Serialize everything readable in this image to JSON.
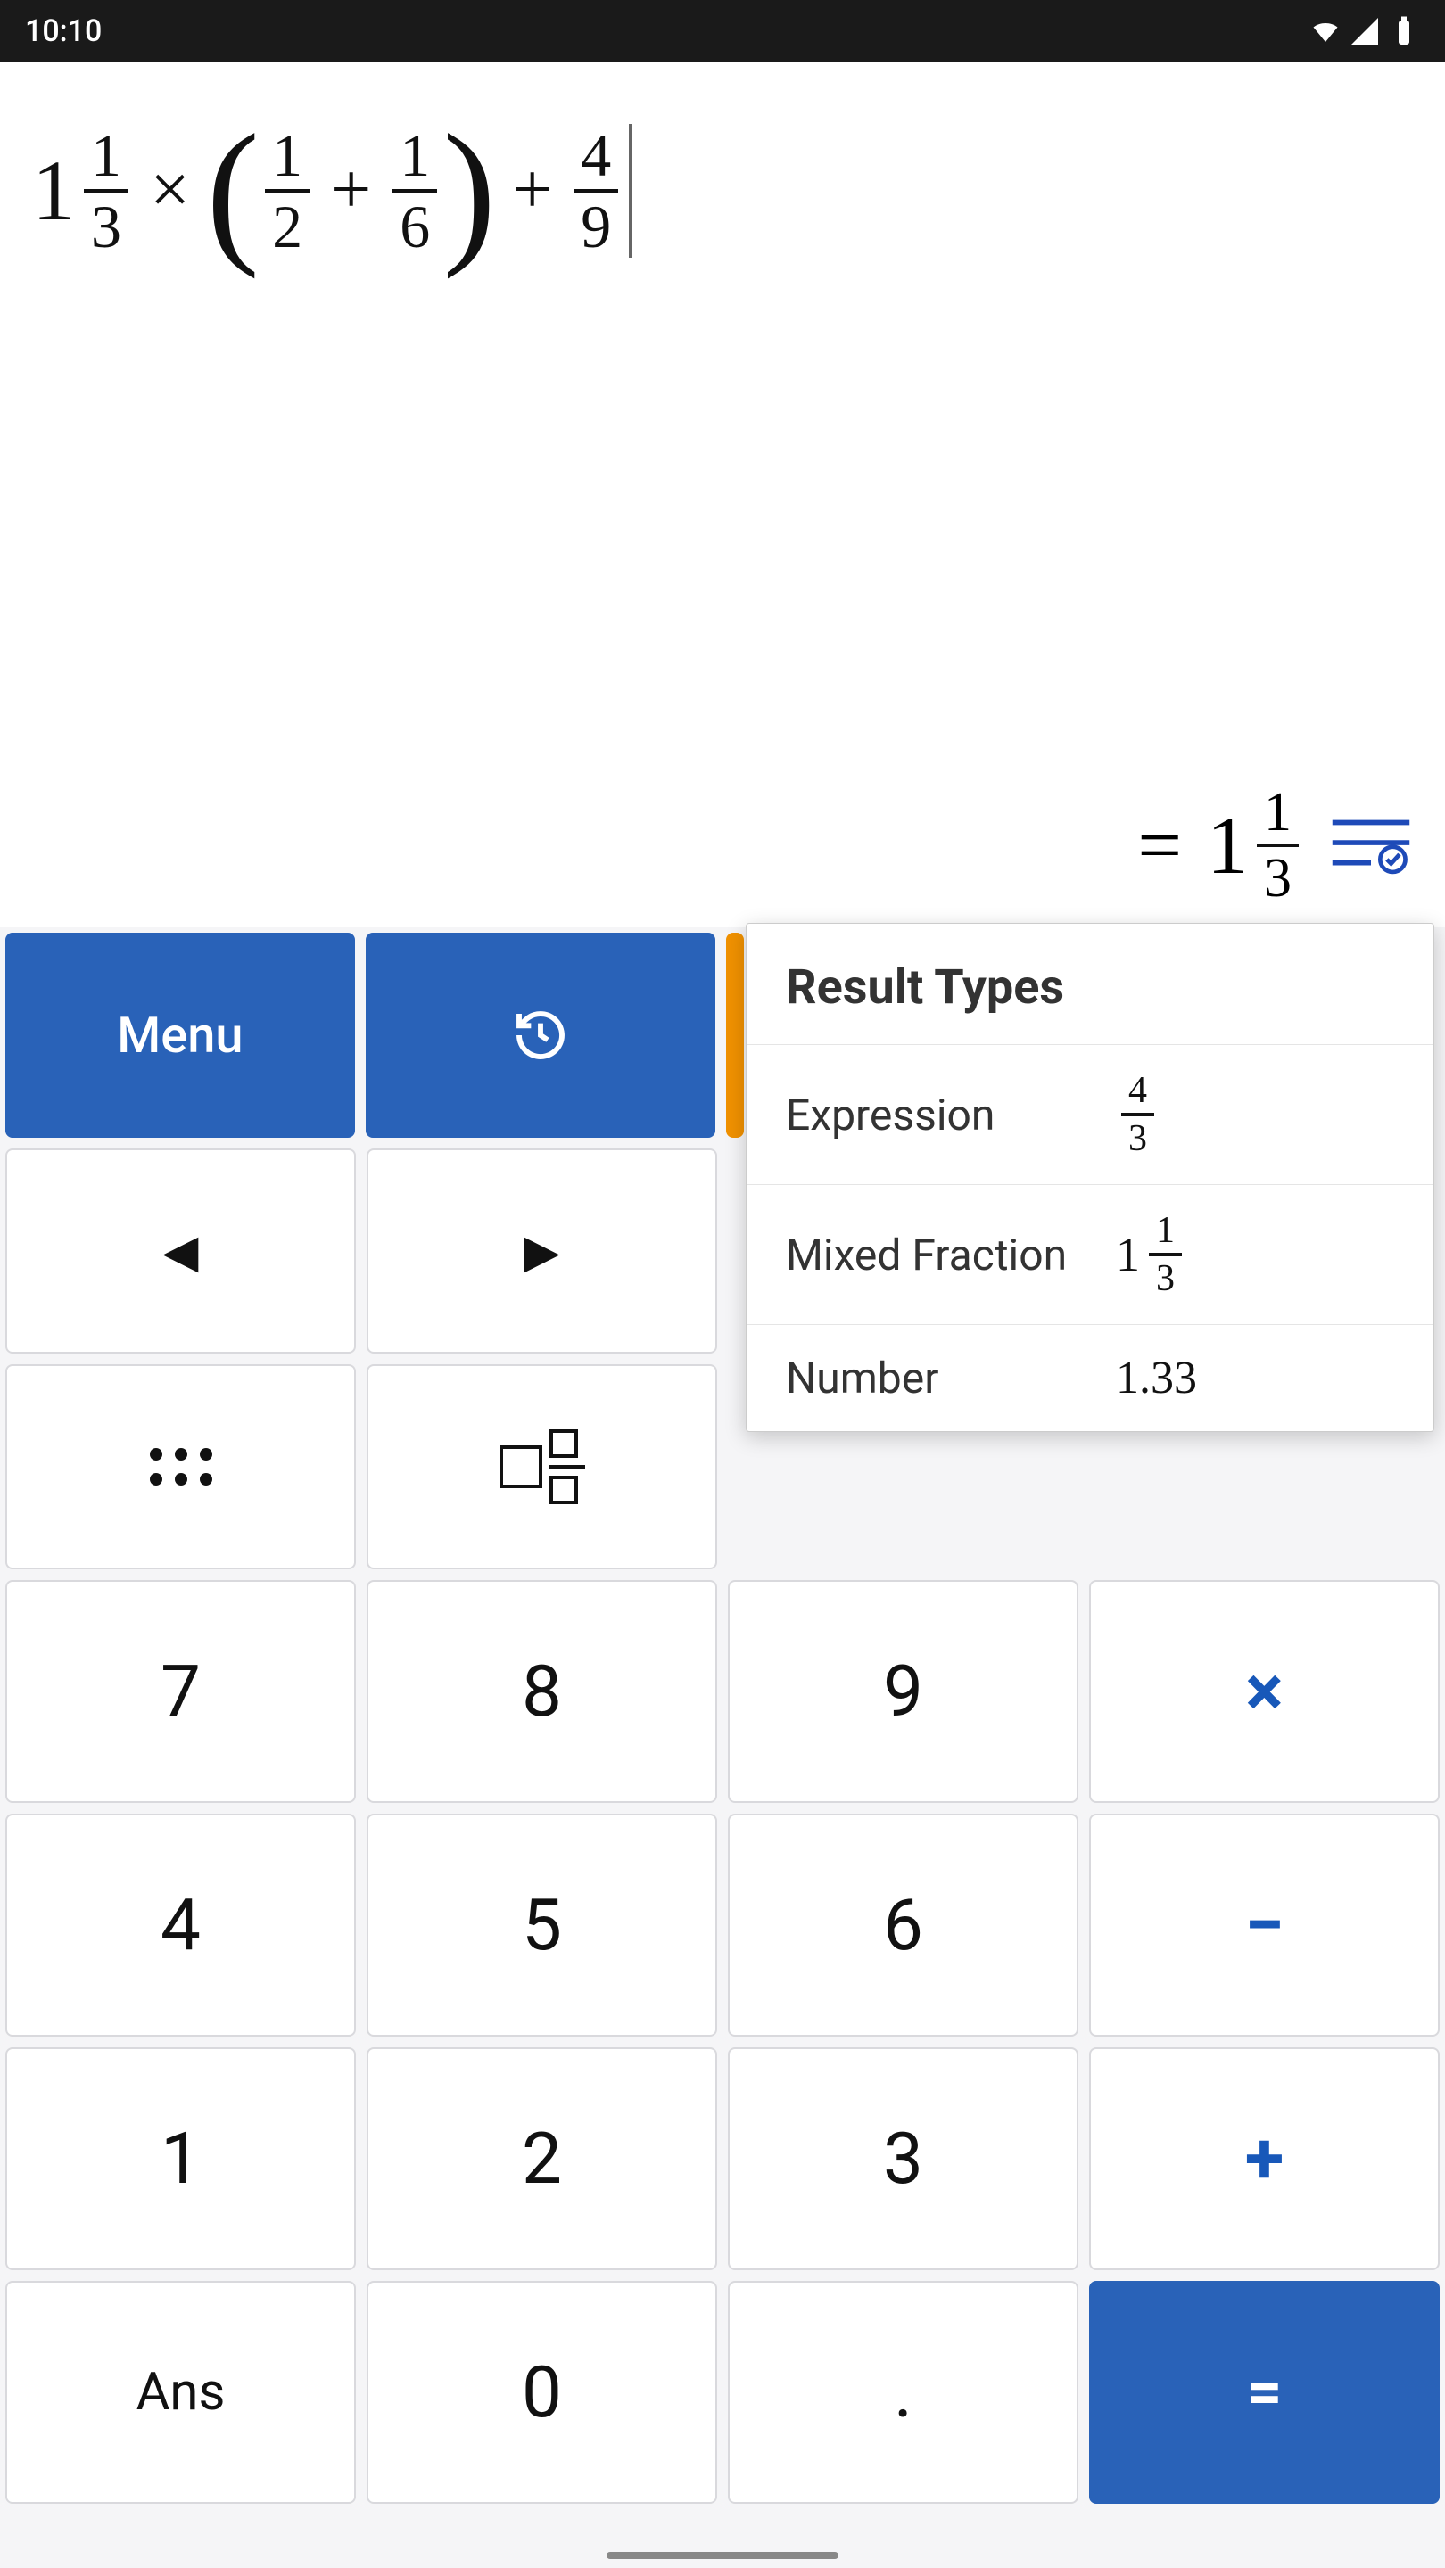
{
  "status": {
    "time": "10:10"
  },
  "expression": {
    "mixed1": {
      "whole": "1",
      "num": "1",
      "den": "3"
    },
    "op1": "×",
    "lparen": "(",
    "rparen": ")",
    "frac1": {
      "num": "1",
      "den": "2"
    },
    "op2": "+",
    "frac2": {
      "num": "1",
      "den": "6"
    },
    "op3": "+",
    "frac3": {
      "num": "4",
      "den": "9"
    }
  },
  "result": {
    "eq": "=",
    "mixed": {
      "whole": "1",
      "num": "1",
      "den": "3"
    }
  },
  "toolbar": {
    "menu": "Menu",
    "history": "",
    "undo": "",
    "clear": ""
  },
  "nav": {
    "left": "◀",
    "right": "▶",
    "dots": "",
    "mixed": ""
  },
  "keypad": {
    "k7": "7",
    "k8": "8",
    "k9": "9",
    "mul": "×",
    "k4": "4",
    "k5": "5",
    "k6": "6",
    "sub": "−",
    "k1": "1",
    "k2": "2",
    "k3": "3",
    "add": "+",
    "ans": "Ans",
    "k0": "0",
    "dot": ".",
    "eq": "="
  },
  "popup": {
    "title": "Result Types",
    "items": [
      {
        "label": "Expression",
        "kind": "frac",
        "num": "4",
        "den": "3"
      },
      {
        "label": "Mixed Fraction",
        "kind": "mixed",
        "whole": "1",
        "num": "1",
        "den": "3"
      },
      {
        "label": "Number",
        "kind": "text",
        "value": "1.33"
      }
    ]
  }
}
